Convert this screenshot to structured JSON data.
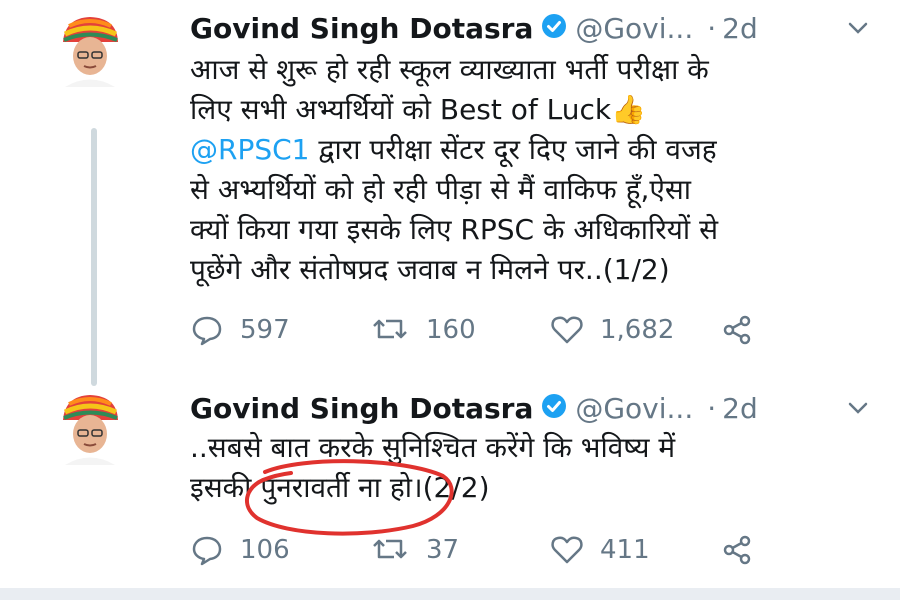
{
  "tweets": [
    {
      "author_name": "Govind Singh Dotasra",
      "handle": "@Govi...",
      "separator": "·",
      "time": "2d",
      "lines": [
        "आज से शुरू हो रही स्कूल व्याख्याता भर्ती परीक्षा के",
        "लिए सभी अभ्यर्थियों को Best of Luck"
      ],
      "mention": "@RPSC1",
      "line3_rest": " द्वारा परीक्षा सेंटर दूर दिए जाने की वजह",
      "lines_after": [
        "से अभ्यर्थियों को हो रही पीड़ा से मैं वाकिफ हूँ,ऐसा",
        "क्यों किया गया इसके लिए RPSC के अधिकारियों से",
        "पूछेंगे और संतोषप्रद जवाब न मिलने पर..(1/2)"
      ],
      "emoji": "👍",
      "replies": "597",
      "retweets": "160",
      "likes": "1,682"
    },
    {
      "author_name": "Govind Singh Dotasra",
      "handle": "@Govi...",
      "separator": "·",
      "time": "2d",
      "lines": [
        "..सबसे बात करके सुनिश्चित करेंगे कि भविष्य में",
        "इसकी पुनरावर्ती ना हो।(2/2)"
      ],
      "replies": "106",
      "retweets": "37",
      "likes": "411"
    }
  ],
  "colors": {
    "verified": "#1da1f2",
    "mention": "#1da1f2",
    "muted": "#657786",
    "annotation": "#e0322e"
  },
  "icons": [
    "reply-icon",
    "retweet-icon",
    "like-icon",
    "share-icon",
    "verified-badge-icon",
    "chevron-down-icon"
  ]
}
